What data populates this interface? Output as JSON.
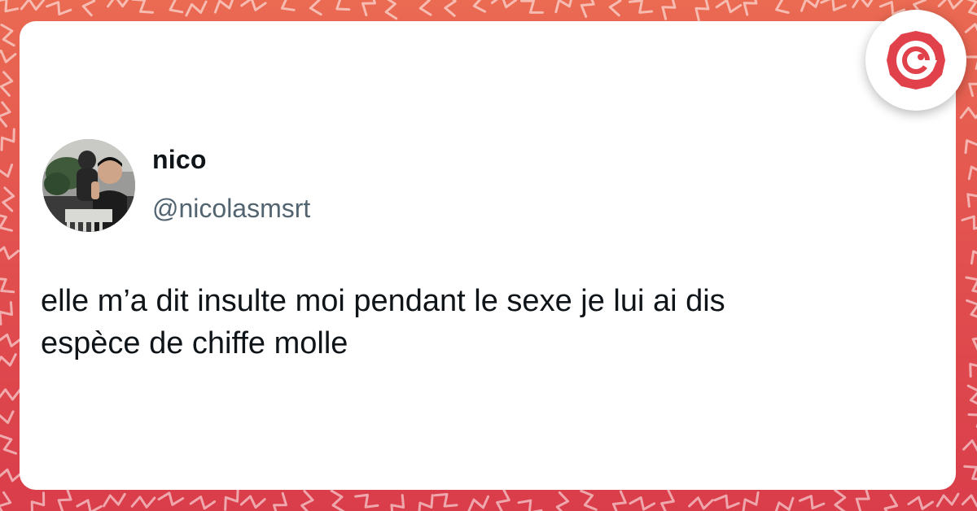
{
  "colors": {
    "background_top": "#ea6a52",
    "background_bottom": "#d93d4a",
    "card": "#ffffff",
    "name_text": "#0f1419",
    "handle_text": "#536471",
    "logo_accent": "#e0414a"
  },
  "icons": {
    "logo": "site-logo-icon",
    "avatar": "profile-photo"
  },
  "tweet": {
    "author_name": "nico",
    "author_handle": "@nicolasmsrt",
    "text_line_1": "elle m’a dit insulte moi pendant le sexe je lui ai dis",
    "text_line_2": "espèce de chiffe molle"
  }
}
